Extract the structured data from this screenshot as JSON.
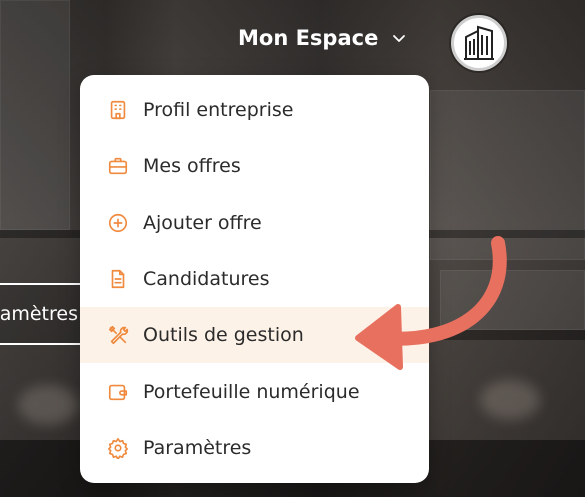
{
  "header": {
    "nav_label": "Mon Espace"
  },
  "side_button": {
    "label": "ramètres"
  },
  "menu": {
    "items": [
      {
        "label": "Profil entreprise",
        "icon": "building-icon"
      },
      {
        "label": "Mes offres",
        "icon": "briefcase-icon"
      },
      {
        "label": "Ajouter offre",
        "icon": "plus-circle-icon"
      },
      {
        "label": "Candidatures",
        "icon": "document-icon"
      },
      {
        "label": "Outils de gestion",
        "icon": "tools-icon",
        "active": true
      },
      {
        "label": "Portefeuille numérique",
        "icon": "wallet-icon"
      },
      {
        "label": "Paramètres",
        "icon": "gear-icon"
      }
    ]
  },
  "colors": {
    "accent": "#ef8a3f",
    "active_bg": "#fdf2e8",
    "arrow": "#e8705f"
  }
}
